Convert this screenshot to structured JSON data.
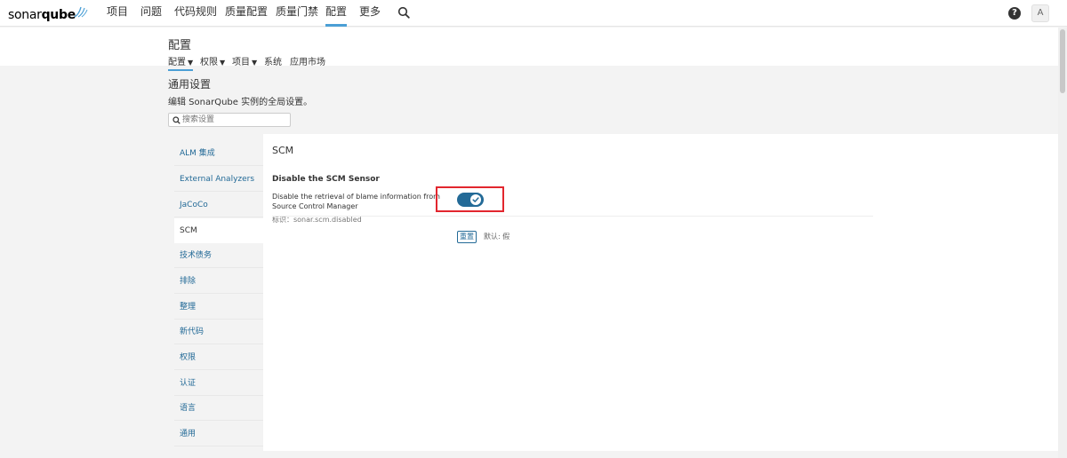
{
  "brand": {
    "name_regular": "sonar",
    "name_bold": "qube"
  },
  "nav": {
    "items": [
      "项目",
      "问题",
      "代码规则",
      "质量配置",
      "质量门禁",
      "配置",
      "更多"
    ],
    "active_index": 5
  },
  "user": {
    "avatar_initial": "A",
    "help_glyph": "?"
  },
  "header": {
    "title": "配置",
    "subnav": [
      {
        "label": "配置",
        "dropdown": true
      },
      {
        "label": "权限",
        "dropdown": true
      },
      {
        "label": "项目",
        "dropdown": true
      },
      {
        "label": "系统",
        "dropdown": false
      },
      {
        "label": "应用市场",
        "dropdown": false
      }
    ],
    "active_subnav": 0
  },
  "general": {
    "title": "通用设置",
    "description": "编辑 SonarQube 实例的全局设置。",
    "search_placeholder": "搜索设置"
  },
  "categories": [
    "ALM 集成",
    "External Analyzers",
    "JaCoCo",
    "SCM",
    "技术债务",
    "排除",
    "整理",
    "新代码",
    "权限",
    "认证",
    "语言",
    "通用"
  ],
  "active_category": "SCM",
  "panel": {
    "title": "SCM",
    "setting": {
      "name": "Disable the SCM Sensor",
      "description": "Disable the retrieval of blame information from Source Control Manager",
      "key": "标识：sonar.scm.disabled",
      "enabled": true,
      "reset_label": "重置",
      "default_label": "默认: 假"
    }
  },
  "colors": {
    "accent": "#4b9fd5",
    "toggle": "#236a97",
    "highlight": "#e2262e"
  }
}
